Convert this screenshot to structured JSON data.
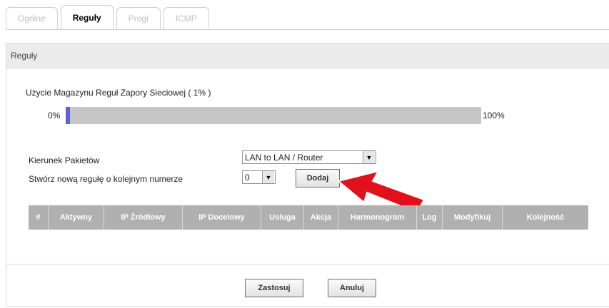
{
  "tabs": [
    {
      "label": "Ogólne",
      "active": false
    },
    {
      "label": "Reguły",
      "active": true
    },
    {
      "label": "Progi",
      "active": false
    },
    {
      "label": "ICMP",
      "active": false
    }
  ],
  "section": {
    "title": "Reguły"
  },
  "usage": {
    "label": "Użycie Magazynu Reguł Zapory Sieciowej ( 1% )",
    "min_label": "0%",
    "max_label": "100%",
    "percent": 1
  },
  "form": {
    "direction_label": "Kierunek Pakietów",
    "direction_value": "LAN to LAN / Router",
    "create_label": "Stwórz nową regułę o kolejnym numerze",
    "rule_number": "0",
    "add_button": "Dodaj"
  },
  "table": {
    "columns": [
      "#",
      "Aktywny",
      "IP Źródłowy",
      "IP Docelowy",
      "Usługa",
      "Akcja",
      "Harmonogram",
      "Log",
      "Modyfikuj",
      "Kolejność"
    ]
  },
  "footer": {
    "apply_button": "Zastosuj",
    "cancel_button": "Anuluj"
  },
  "colors": {
    "annotation_arrow": "#e0101c",
    "usage_fill": "#5f5fd6",
    "table_header_bg": "#b0b0b0"
  }
}
